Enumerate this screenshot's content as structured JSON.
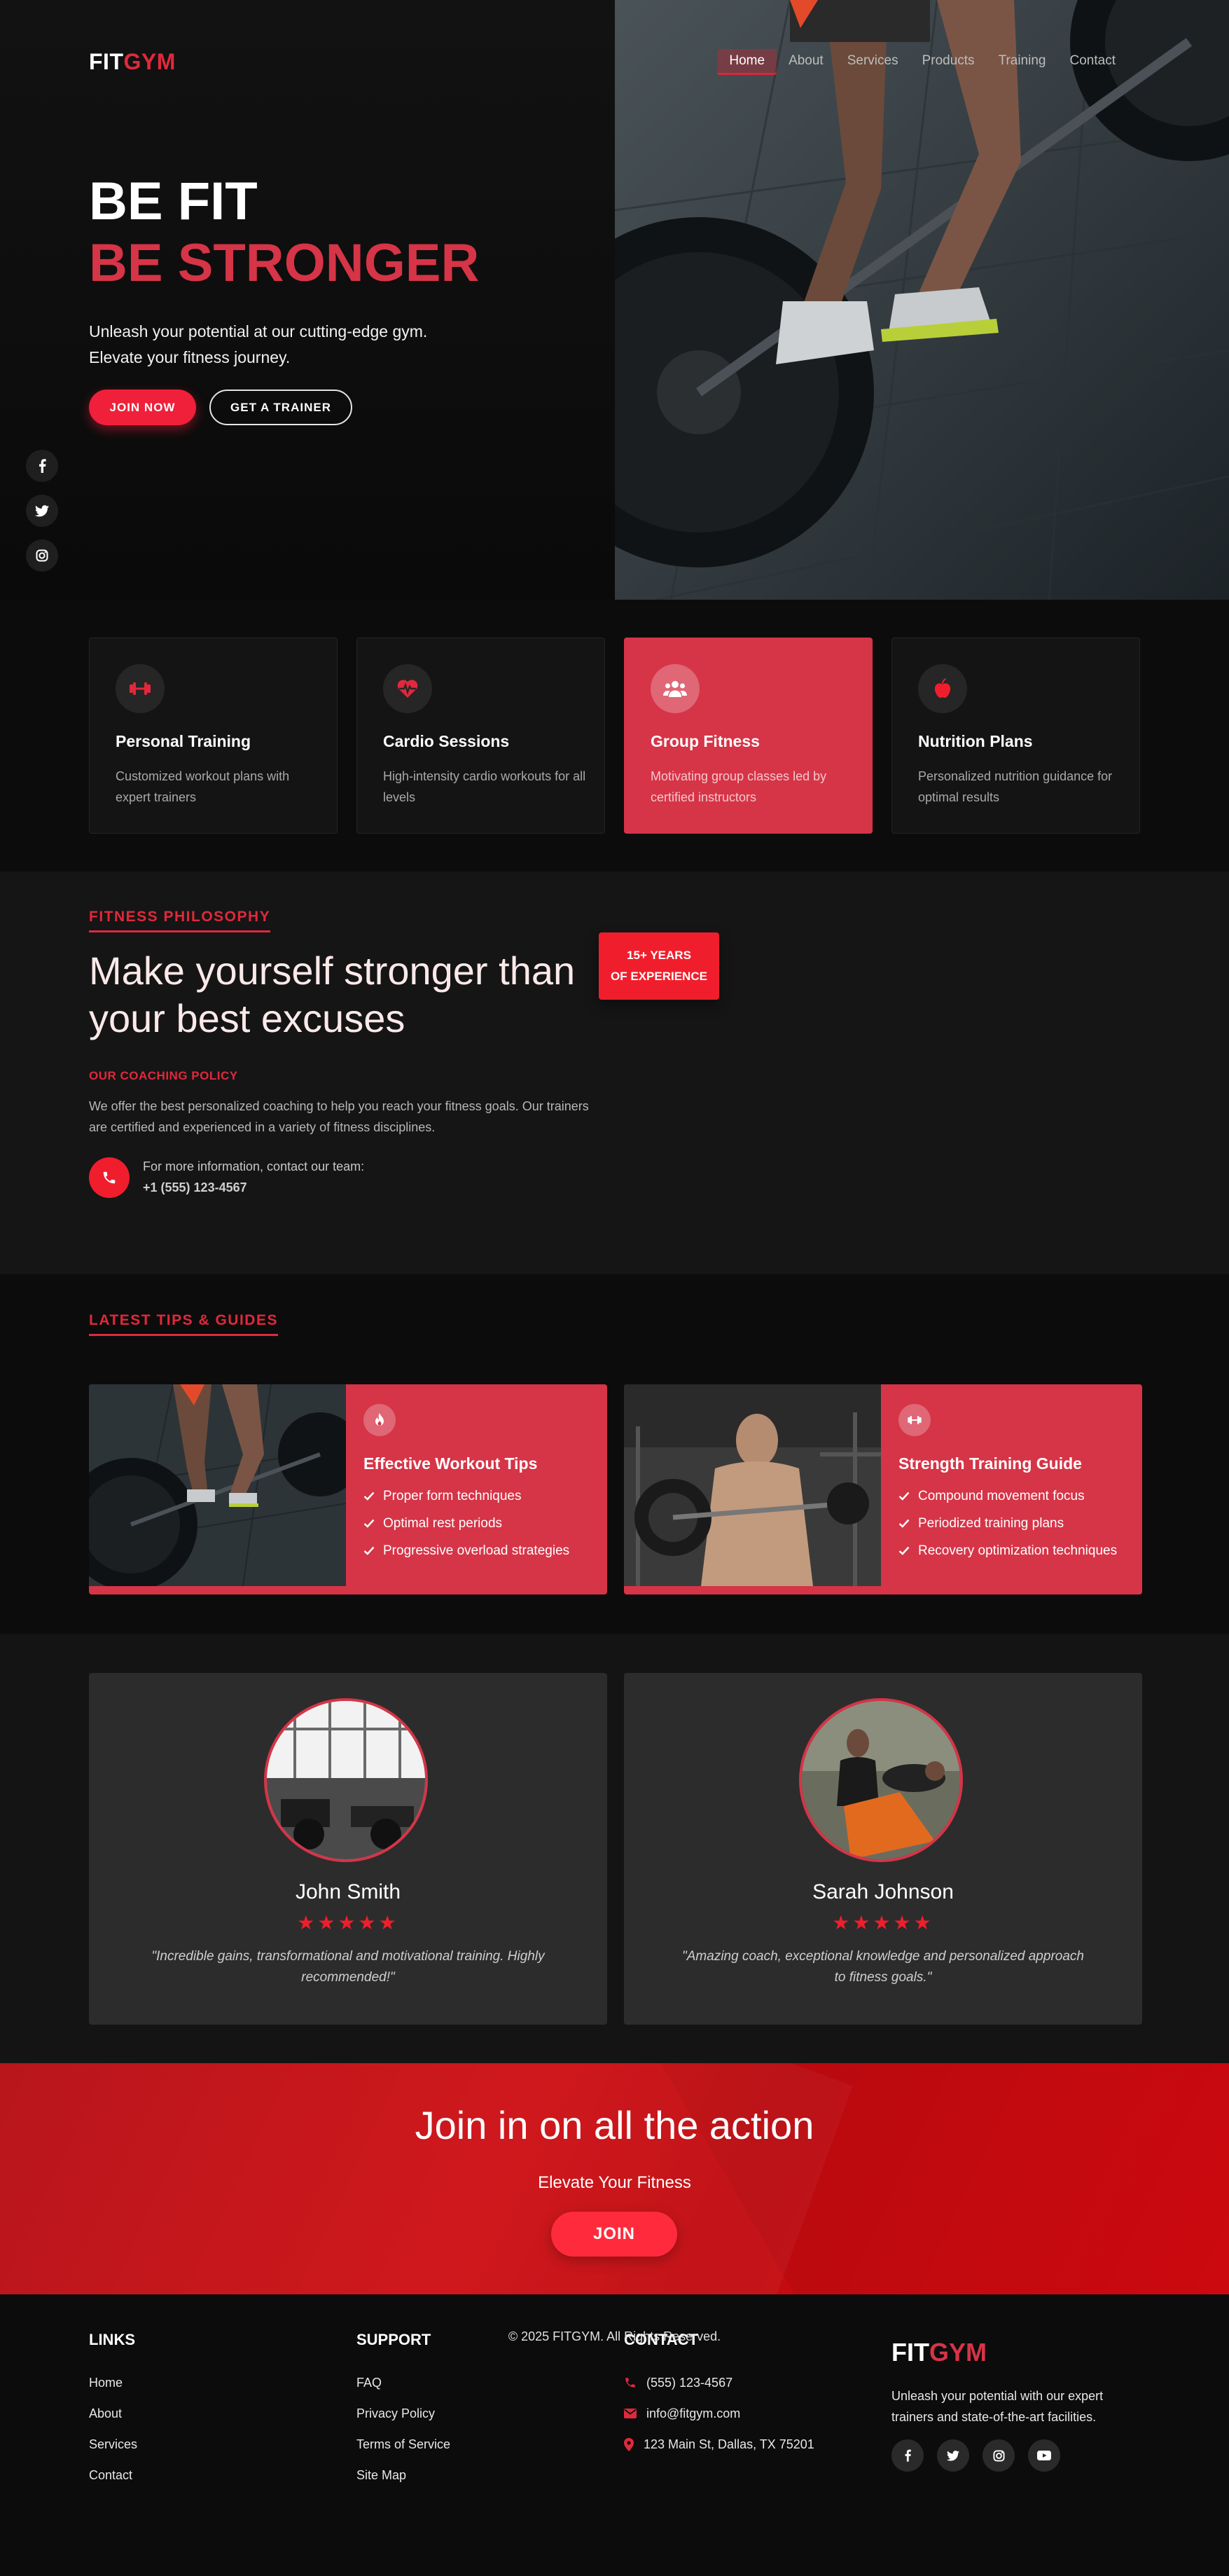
{
  "brand": {
    "part1": "FIT",
    "part2": "GYM"
  },
  "nav": {
    "items": [
      "Home",
      "About",
      "Services",
      "Products",
      "Training",
      "Contact"
    ],
    "active": "Home"
  },
  "hero": {
    "title_line1": "BE FIT",
    "title_line2": "BE STRONGER",
    "subtitle": "Unleash your potential at our cutting-edge gym. Elevate your fitness journey.",
    "join_label": "JOIN NOW",
    "trainer_label": "GET A TRAINER",
    "social_icons": [
      "facebook-icon",
      "twitter-icon",
      "instagram-icon"
    ]
  },
  "services": [
    {
      "icon": "dumbbell-icon",
      "title": "Personal Training",
      "desc": "Customized workout plans with expert trainers",
      "highlighted": false
    },
    {
      "icon": "heartbeat-icon",
      "title": "Cardio Sessions",
      "desc": "High-intensity cardio workouts for all levels",
      "highlighted": false
    },
    {
      "icon": "group-icon",
      "title": "Group Fitness",
      "desc": "Motivating group classes led by certified instructors",
      "highlighted": true
    },
    {
      "icon": "apple-icon",
      "title": "Nutrition Plans",
      "desc": "Personalized nutrition guidance for optimal results",
      "highlighted": false
    }
  ],
  "philosophy": {
    "eyebrow": "FITNESS PHILOSOPHY",
    "heading": "Make yourself stronger than your best excuses",
    "badge_line1": "15+ YEARS",
    "badge_line2": "OF EXPERIENCE",
    "sub_eyebrow": "OUR COACHING POLICY",
    "paragraph": "We offer the best personalized coaching to help you reach your fitness goals. Our trainers are certified and experienced in a variety of fitness disciplines.",
    "contact_text": "For more information, contact our team:",
    "contact_phone": "+1 (555) 123-4567"
  },
  "tips": {
    "eyebrow": "LATEST TIPS & GUIDES",
    "cards": [
      {
        "icon": "fire-icon",
        "title": "Effective Workout Tips",
        "items": [
          "Proper form techniques",
          "Optimal rest periods",
          "Progressive overload strategies"
        ]
      },
      {
        "icon": "dumbbell-icon",
        "title": "Strength Training Guide",
        "items": [
          "Compound movement focus",
          "Periodized training plans",
          "Recovery optimization techniques"
        ]
      }
    ]
  },
  "testimonials": [
    {
      "name": "John Smith",
      "stars": "★★★★★",
      "rating": 5,
      "quote": "\"Incredible gains, transformational and motivational training. Highly recommended!\""
    },
    {
      "name": "Sarah Johnson",
      "stars": "★★★★★",
      "rating": 5,
      "quote": "\"Amazing coach, exceptional knowledge and personalized approach to fitness goals.\""
    }
  ],
  "cta": {
    "heading": "Join in on all the action",
    "subheading": "Elevate Your Fitness",
    "button": "JOIN"
  },
  "footer": {
    "links_heading": "LINKS",
    "links": [
      "Home",
      "About",
      "Services",
      "Contact"
    ],
    "support_heading": "SUPPORT",
    "support": [
      "FAQ",
      "Privacy Policy",
      "Terms of Service",
      "Site Map"
    ],
    "contact_heading": "CONTACT",
    "contact": [
      {
        "icon": "phone-icon",
        "text": "(555) 123-4567"
      },
      {
        "icon": "envelope-icon",
        "text": "info@fitgym.com"
      },
      {
        "icon": "map-marker-icon",
        "text": "123 Main St, Dallas, TX 75201"
      }
    ],
    "description": "Unleash your potential with our expert trainers and state-of-the-art facilities.",
    "social_icons": [
      "facebook-icon",
      "twitter-icon",
      "instagram-icon",
      "youtube-icon"
    ],
    "copyright": "© 2025 FITGYM. All Rights Reserved."
  },
  "colors": {
    "accent": "#d63447",
    "bright_red": "#f01e2c",
    "background": "#0c0c0c",
    "card": "#141414"
  }
}
